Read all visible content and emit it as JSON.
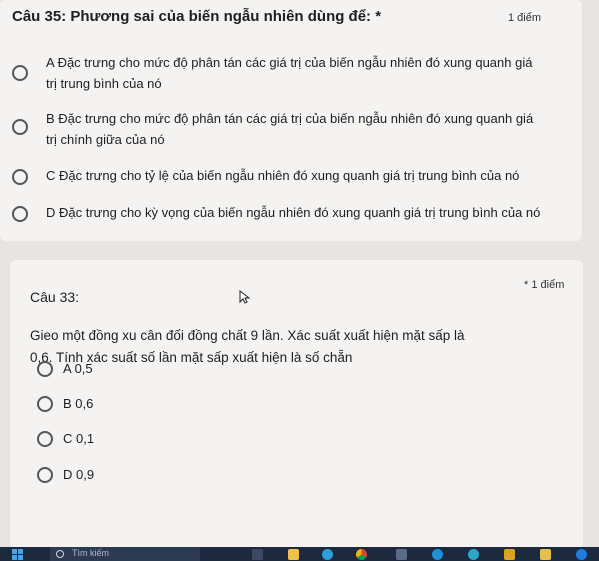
{
  "question35": {
    "title": "Câu 35: Phương sai của biến ngẫu nhiên dùng để: *",
    "points": "1 điểm",
    "options": [
      {
        "line1": "A Đặc trưng cho mức độ phân tán các giá trị của biến ngẫu nhiên đó xung quanh giá",
        "line2": "trị trung bình của nó"
      },
      {
        "line1": "B Đặc trưng cho mức độ phân tán các giá trị của biến ngẫu nhiên đó xung quanh giá",
        "line2": "trị chính giữa của nó"
      },
      {
        "line1": "C Đặc trưng cho tỷ lệ của biến ngẫu nhiên đó xung quanh giá trị trung bình của nó"
      },
      {
        "line1": "D Đặc trưng cho kỳ vọng của biến ngẫu nhiên đó xung quanh giá trị trung bình của nó"
      }
    ]
  },
  "question33": {
    "title": "Câu 33:",
    "points": "* 1 điểm",
    "body_line1": "Gieo một đồng xu cân đối đồng chất 9 lần. Xác suất xuất hiện mặt sấp là",
    "body_line2": "0,6. Tính xác suất số lần mặt sấp xuất hiện là số chẵn",
    "options": [
      "A 0,5",
      "B 0,6",
      "C 0,1",
      "D 0,9"
    ]
  },
  "taskbar": {
    "search_placeholder": "Tìm kiếm",
    "icons": [
      "start-icon",
      "task-view-icon",
      "file-explorer-icon",
      "edge-icon",
      "chrome-icon",
      "store-icon",
      "word-icon",
      "teams-icon",
      "mail-icon",
      "folder-icon",
      "zalo-icon"
    ]
  }
}
